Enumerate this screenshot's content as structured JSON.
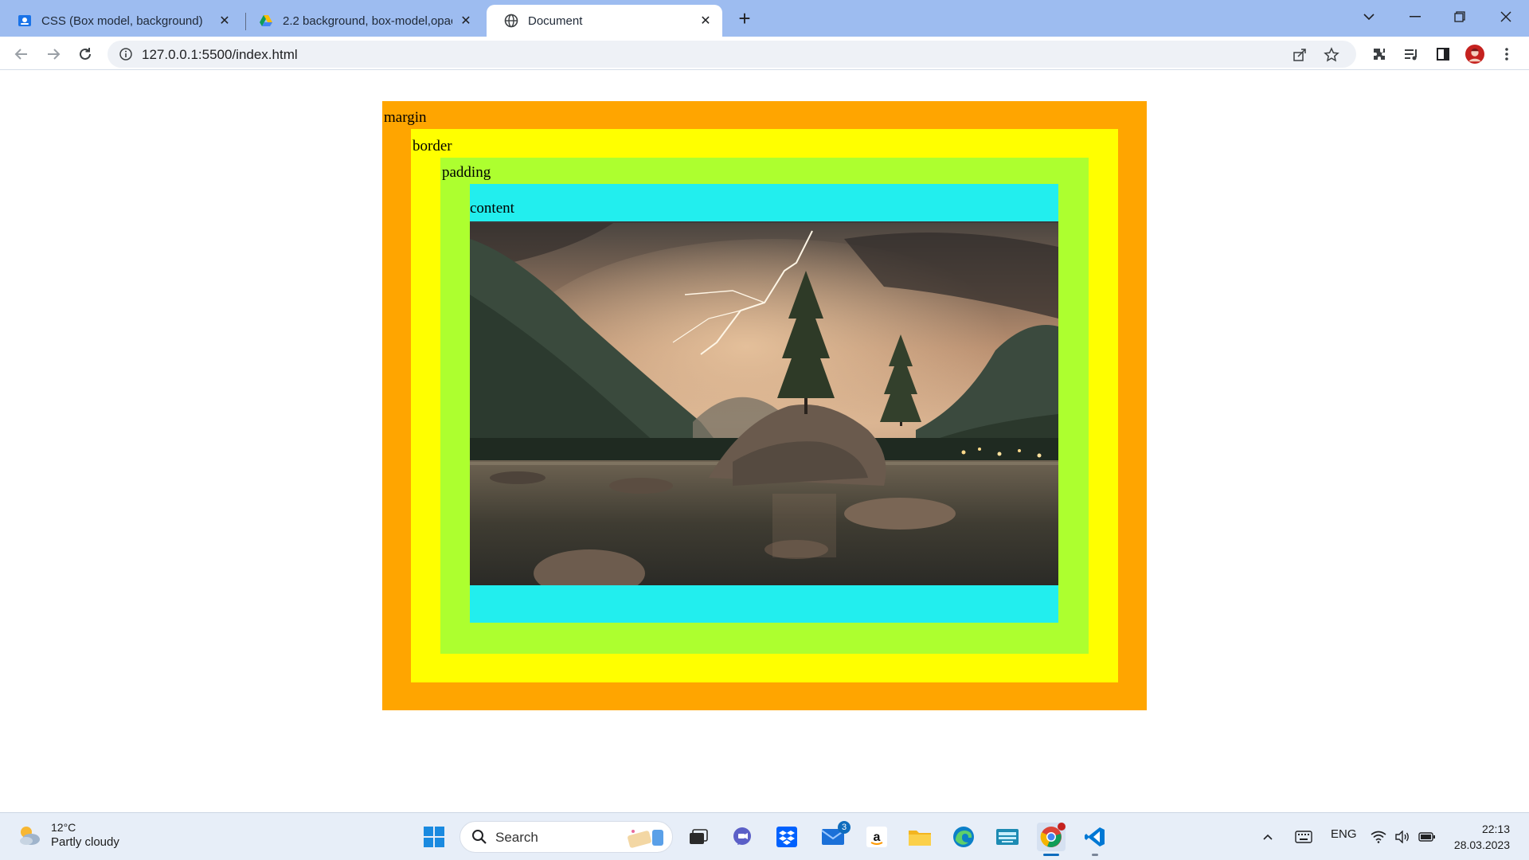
{
  "browser": {
    "tabs": [
      {
        "title": "CSS (Box model, background)",
        "icon": "classroom-icon"
      },
      {
        "title": "2.2 background, box-model,opac",
        "icon": "google-drive-icon"
      },
      {
        "title": "Document",
        "icon": "globe-icon",
        "active": true
      }
    ],
    "url": "127.0.0.1:5500/index.html"
  },
  "page": {
    "labels": {
      "margin": "margin",
      "border": "border",
      "padding": "padding",
      "content": "content"
    },
    "colors": {
      "margin": "#ffa500",
      "border": "#ffff00",
      "padding": "#adff2f",
      "content": "#22eeee"
    },
    "image": {
      "subject": "lake-with-lightning-and-trees-photo"
    }
  },
  "taskbar": {
    "weather": {
      "temp": "12°C",
      "condition": "Partly cloudy"
    },
    "search_label": "Search",
    "mail_badge": "3",
    "lang": "ENG",
    "time": "22:13",
    "date": "28.03.2023"
  }
}
